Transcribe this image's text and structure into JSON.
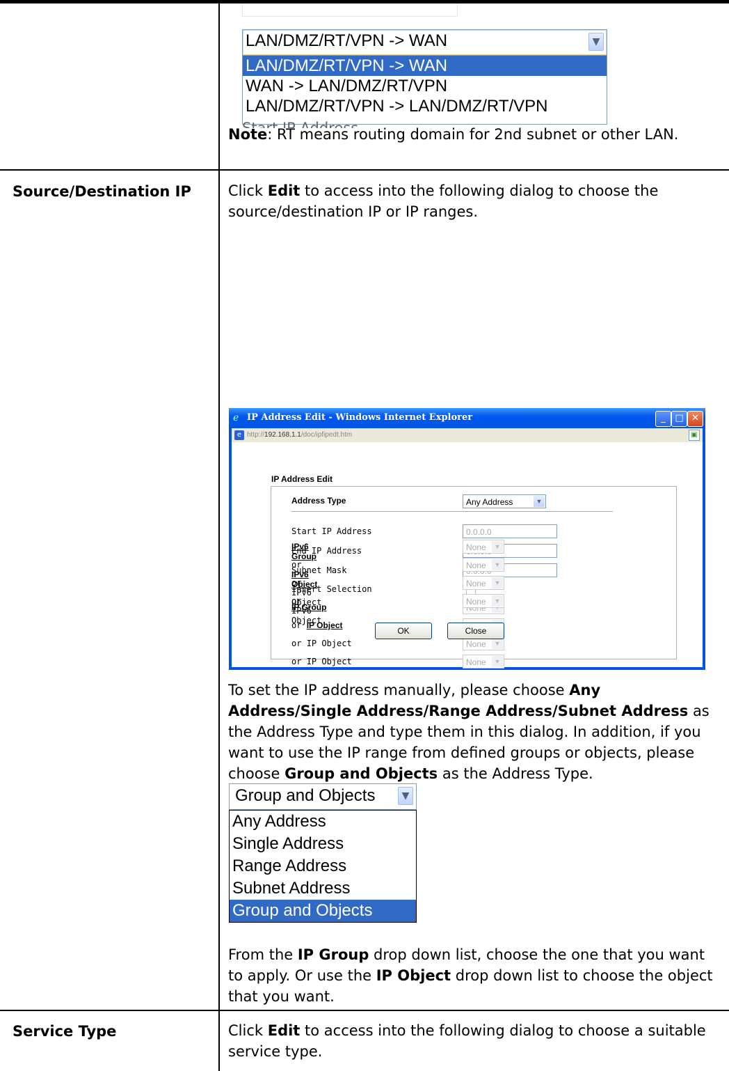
{
  "rows": {
    "source_destination": {
      "label": "Source/Destination IP",
      "intro_a": "Click ",
      "intro_edit": "Edit",
      "intro_b": " to access into the following dialog to choose the source/destination IP or IP ranges.",
      "p2_a": "To set the IP address manually, please choose ",
      "p2_b1": "Any Address/Single Address/Range Address/Subnet Address",
      "p2_c": " as the Address Type and type them in this dialog. In addition, if you want to use the IP range from defined groups or objects, please choose ",
      "p2_b2": "Group and Objects",
      "p2_d": " as the Address Type.",
      "p3_a": "From the ",
      "p3_b1": "IP Group",
      "p3_c": " drop down list, choose the one that you want to apply. Or use the ",
      "p3_b2": "IP Object",
      "p3_d": " drop down list to choose the object that you want."
    },
    "service_type": {
      "label": "Service Type",
      "intro_a": "Click ",
      "intro_edit": "Edit",
      "intro_b": " to access into the following dialog to choose a suitable service type."
    }
  },
  "direction_dropdown": {
    "selected": "LAN/DMZ/RT/VPN -> WAN",
    "options": [
      "LAN/DMZ/RT/VPN -> WAN",
      "WAN -> LAN/DMZ/RT/VPN",
      "LAN/DMZ/RT/VPN -> LAN/DMZ/RT/VPN"
    ],
    "ghost_text": "Start IP Address"
  },
  "note": {
    "label": "Note",
    "text": ": RT means routing domain for 2nd subnet or other LAN."
  },
  "ie_dialog": {
    "title": "IP Address Edit - Windows Internet Explorer",
    "url_prefix": "http://",
    "url_host": "192.168.1.1",
    "url_path": "/doc/ipfipedt.htm",
    "heading": "IP Address Edit",
    "address_type_label": "Address Type",
    "address_type_value": "Any Address",
    "start_ip_label": "Start IP Address",
    "start_ip_value": "0.0.0.0",
    "end_ip_label": "End IP Address",
    "end_ip_value": "0.0.0.0",
    "subnet_mask_label": "Subnet Mask",
    "subnet_mask_value": "0.0.0.0",
    "invert_label": "Invert Selection",
    "or_prefix": "or ",
    "ip_group_label": "IP Group",
    "ip_object_label": "IP Object",
    "ipv6_group_label": "IPv6 Group",
    "ipv6_object_label": "IPv6 Object",
    "none_value": "None",
    "ok_label": "OK",
    "close_label": "Close"
  },
  "address_type_dropdown": {
    "selected": "Group and Objects",
    "options": [
      "Any Address",
      "Single Address",
      "Range Address",
      "Subnet Address",
      "Group and Objects"
    ]
  }
}
